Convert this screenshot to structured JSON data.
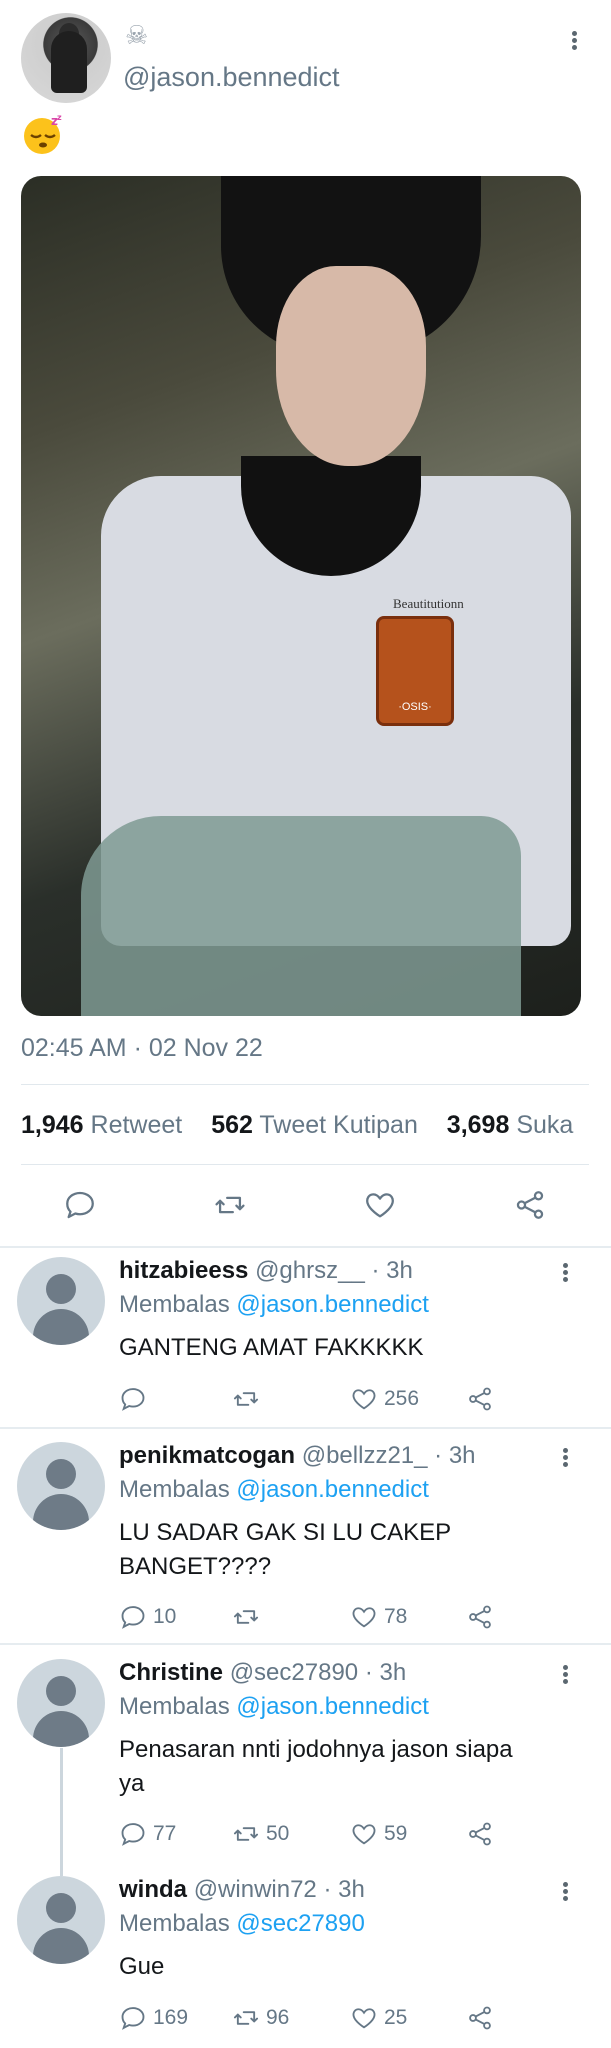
{
  "tweet": {
    "author_handle": "@jason.bennedict",
    "name_icon": "skull-icon",
    "text_emoji": "sleepy-face-emoji",
    "image": "photo-of-boy-in-school-uniform",
    "image_badge_text": "Beautitutionn",
    "image_badge_label": "·OSIS·",
    "timestamp": "02:45 AM · 02 Nov 22",
    "stats": {
      "retweets_count": "1,946",
      "retweets_label": "Retweet",
      "quotes_count": "562",
      "quotes_label": "Tweet Kutipan",
      "likes_count": "3,698",
      "likes_label": "Suka"
    },
    "actions": [
      "reply-icon",
      "retweet-icon",
      "like-icon",
      "share-icon"
    ]
  },
  "replies": [
    {
      "name": "hitzabieess",
      "handle": "@ghrsz__",
      "time": "· 3h",
      "replying_label": "Membalas",
      "replying_to": "@jason.bennedict",
      "text": "GANTENG AMAT FAKKKKK",
      "reply_count": "",
      "retweet_count": "",
      "like_count": "256"
    },
    {
      "name": "penikmatcogan",
      "handle": "@bellzz21_",
      "time": "· 3h",
      "replying_label": "Membalas",
      "replying_to": "@jason.bennedict",
      "text_line1": "LU SADAR GAK SI LU CAKEP",
      "text_line2": "BANGET????",
      "reply_count": "10",
      "retweet_count": "",
      "like_count": "78"
    },
    {
      "name": "Christine",
      "handle": "@sec27890",
      "time": "· 3h",
      "replying_label": "Membalas",
      "replying_to": "@jason.bennedict",
      "text_line1": "Penasaran nnti jodohnya jason siapa",
      "text_line2": "ya",
      "reply_count": "77",
      "retweet_count": "50",
      "like_count": "59"
    },
    {
      "name": "winda",
      "handle": "@winwin72",
      "time": "· 3h",
      "replying_label": "Membalas",
      "replying_to": "@sec27890",
      "text": "Gue",
      "reply_count": "169",
      "retweet_count": "96",
      "like_count": "25"
    }
  ],
  "colors": {
    "link": "#1da1f2",
    "muted": "#657786",
    "text": "#14171a",
    "divider": "#e1e8ed"
  }
}
